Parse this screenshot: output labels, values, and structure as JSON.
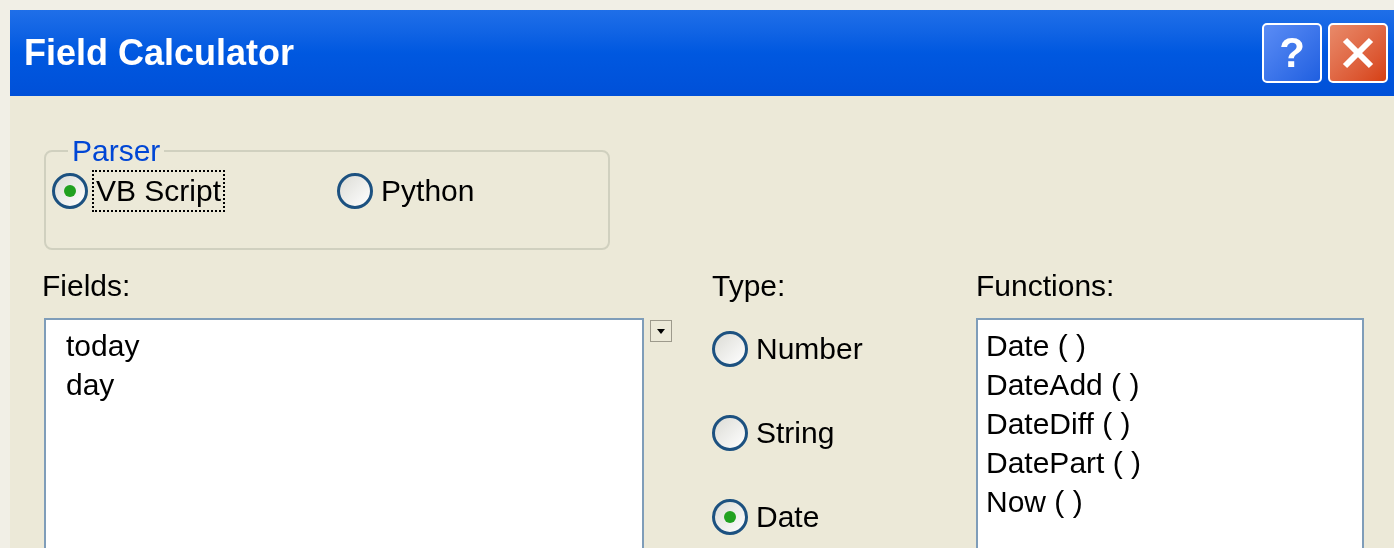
{
  "window": {
    "title": "Field Calculator",
    "buttons": [
      {
        "kind": "help",
        "label": "?"
      },
      {
        "kind": "close"
      }
    ]
  },
  "parser": {
    "label": "Parser",
    "options": [
      {
        "label": "VB Script",
        "selected": true,
        "focused": true
      },
      {
        "label": "Python",
        "selected": false,
        "focused": false
      }
    ]
  },
  "fields": {
    "label": "Fields:",
    "items": [
      "today",
      "day"
    ]
  },
  "type": {
    "label": "Type:",
    "options": [
      {
        "label": "Number",
        "selected": false
      },
      {
        "label": "String",
        "selected": false
      },
      {
        "label": "Date",
        "selected": true
      }
    ]
  },
  "functions": {
    "label": "Functions:",
    "items": [
      "Date ( )",
      "DateAdd ( )",
      "DateDiff ( )",
      "DatePart ( )",
      "Now ( )"
    ]
  }
}
